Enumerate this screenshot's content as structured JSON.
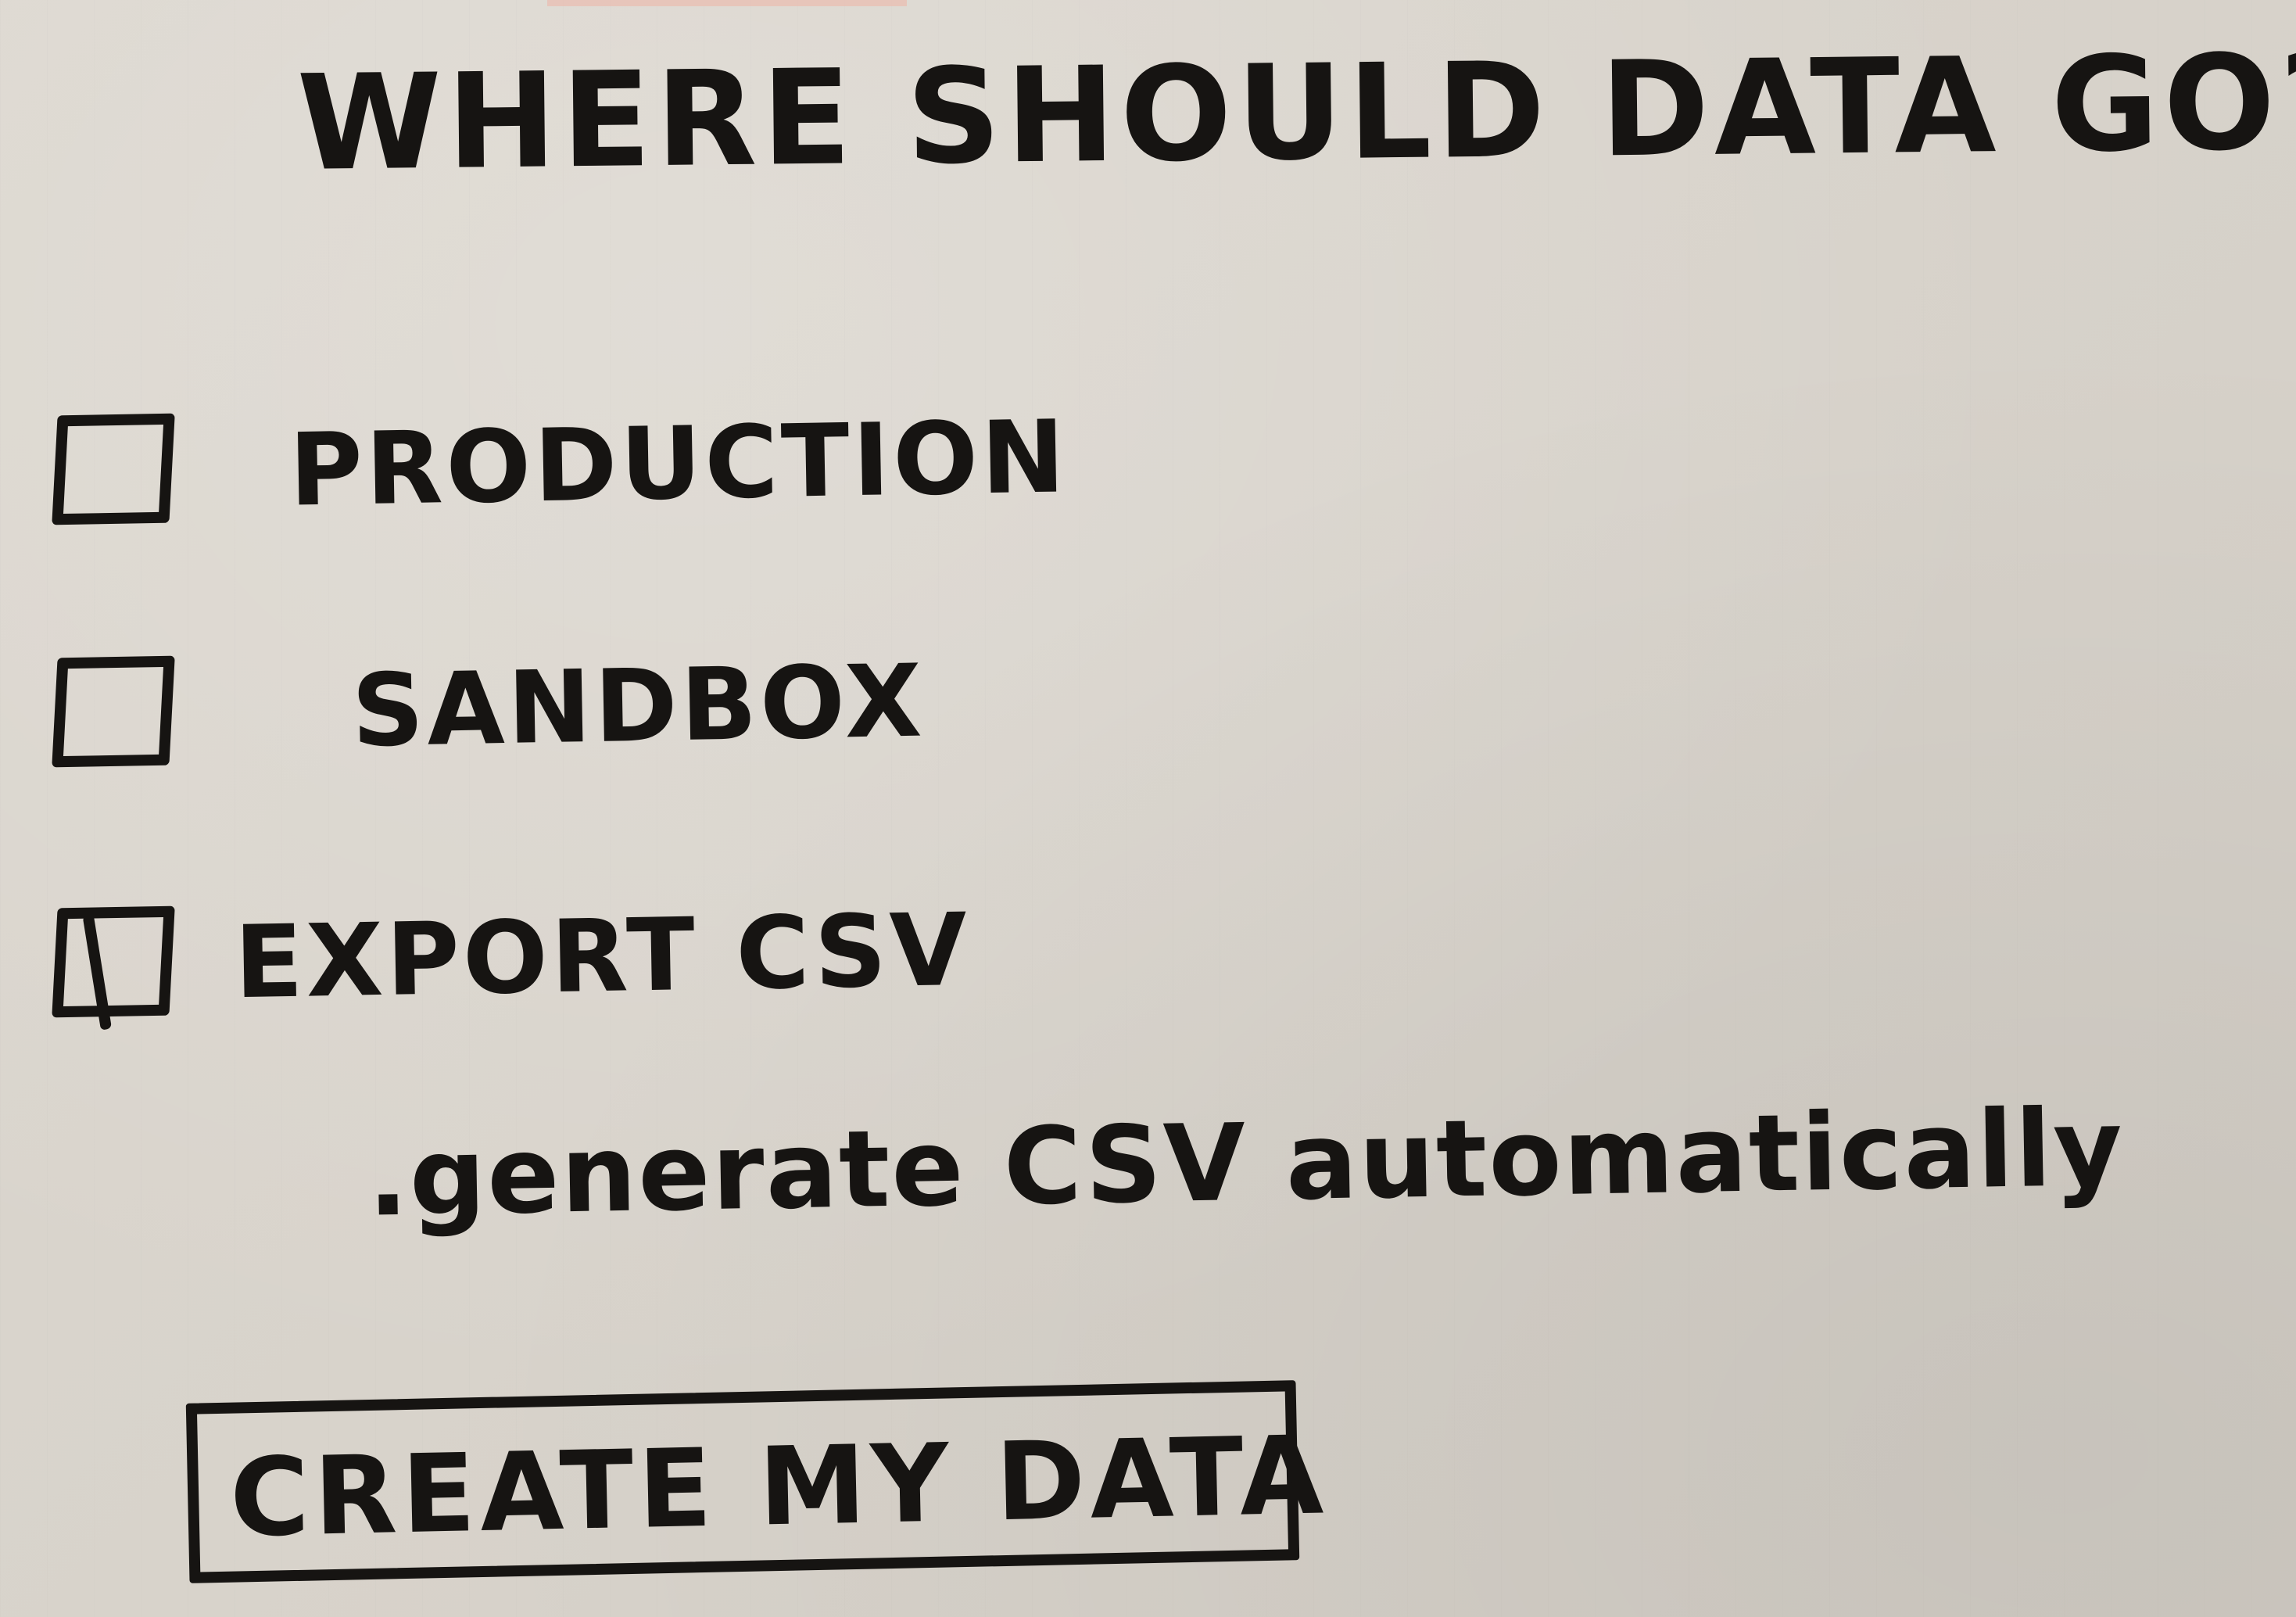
{
  "heading": "WHERE SHOULD DATA GO?",
  "options": [
    {
      "label": "PRODUCTION",
      "checked": false
    },
    {
      "label": "SANDBOX",
      "checked": false
    },
    {
      "label": "EXPORT CSV",
      "checked": true
    }
  ],
  "export_sub_option": ".generate CSV automatically",
  "create_button_label": "CREATE MY DATA",
  "colors": {
    "ink": "#161412",
    "paper": "#d9d4cc"
  }
}
